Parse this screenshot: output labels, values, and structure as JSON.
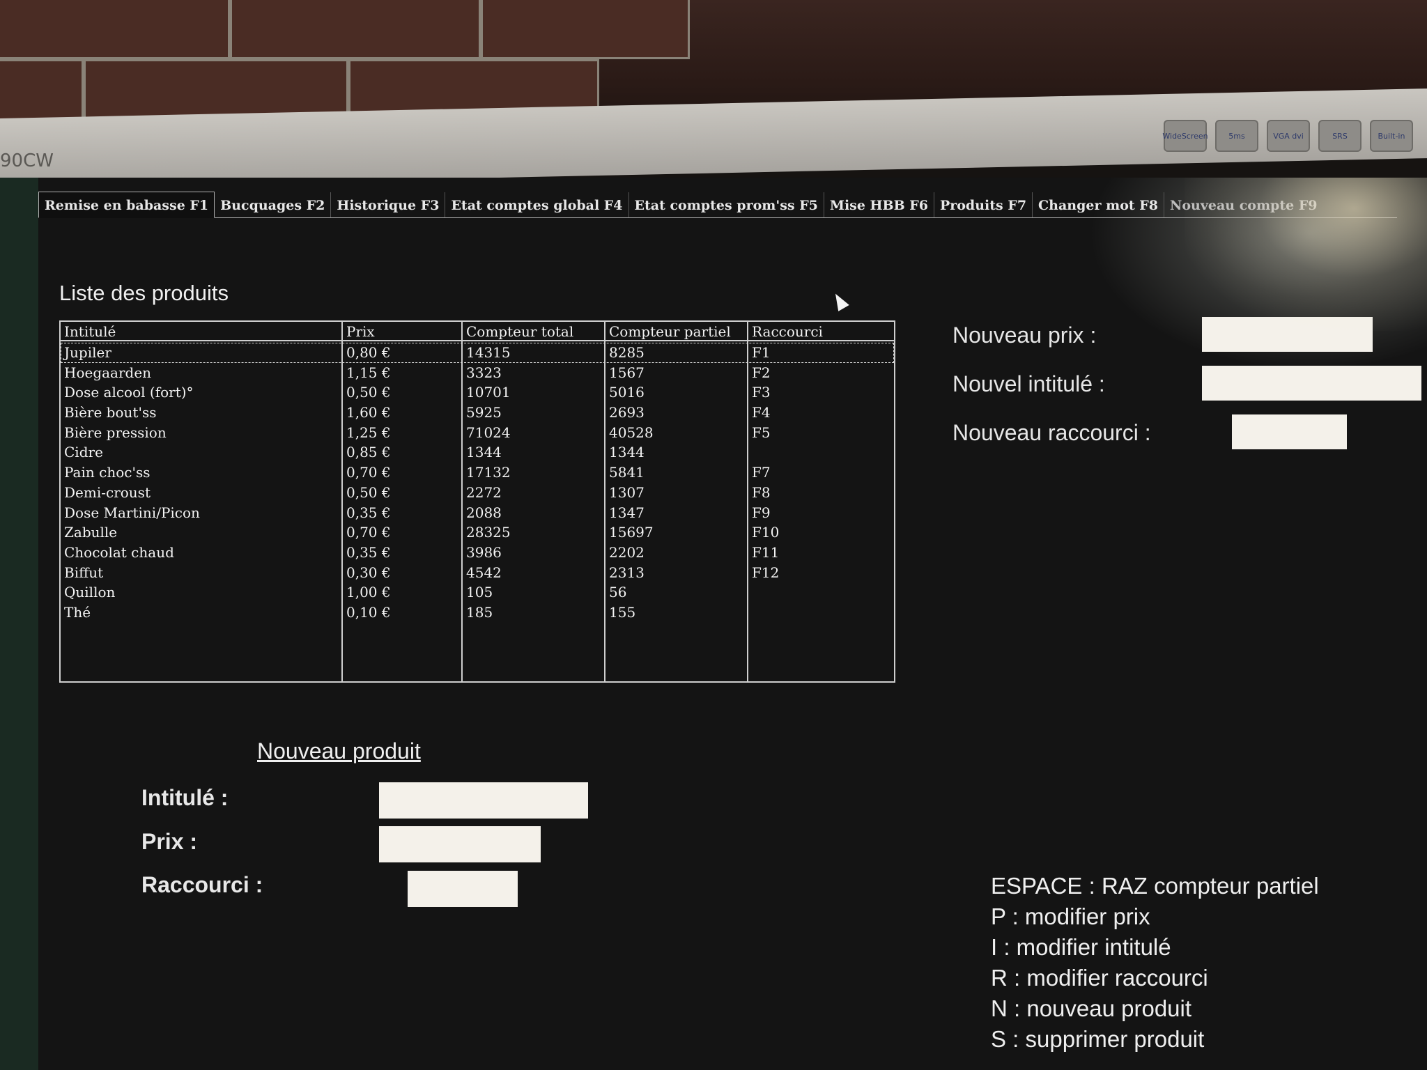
{
  "bezel": {
    "model": "90CW",
    "badges": [
      "WideScreen",
      "5ms",
      "VGA dvi",
      "SRS",
      "Built-in"
    ]
  },
  "tabs": [
    {
      "label": "Remise en babasse F1",
      "active": true
    },
    {
      "label": "Bucquages F2",
      "active": false
    },
    {
      "label": "Historique F3",
      "active": false
    },
    {
      "label": "Etat comptes global F4",
      "active": false
    },
    {
      "label": "Etat comptes prom'ss F5",
      "active": false
    },
    {
      "label": "Mise HBB F6",
      "active": false
    },
    {
      "label": "Produits F7",
      "active": false
    },
    {
      "label": "Changer mot F8",
      "active": false
    },
    {
      "label": "Nouveau compte F9",
      "active": false
    }
  ],
  "products": {
    "title": "Liste des produits",
    "columns": [
      "Intitulé",
      "Prix",
      "Compteur total",
      "Compteur partiel",
      "Raccourci"
    ],
    "rows": [
      [
        "Jupiler",
        "0,80 €",
        "14315",
        "8285",
        "F1"
      ],
      [
        "Hoegaarden",
        "1,15 €",
        "3323",
        "1567",
        "F2"
      ],
      [
        "Dose alcool (fort)°",
        "0,50 €",
        "10701",
        "5016",
        "F3"
      ],
      [
        "Bière bout'ss",
        "1,60 €",
        "5925",
        "2693",
        "F4"
      ],
      [
        "Bière pression",
        "1,25 €",
        "71024",
        "40528",
        "F5"
      ],
      [
        "Cidre",
        "0,85 €",
        "1344",
        "1344",
        ""
      ],
      [
        "Pain choc'ss",
        "0,70 €",
        "17132",
        "5841",
        "F7"
      ],
      [
        "Demi-croust",
        "0,50 €",
        "2272",
        "1307",
        "F8"
      ],
      [
        "Dose Martini/Picon",
        "0,35 €",
        "2088",
        "1347",
        "F9"
      ],
      [
        "Zabulle",
        "0,70 €",
        "28325",
        "15697",
        "F10"
      ],
      [
        "Chocolat chaud",
        "0,35 €",
        "3986",
        "2202",
        "F11"
      ],
      [
        "Biffut",
        "0,30 €",
        "4542",
        "2313",
        "F12"
      ],
      [
        "Quillon",
        "1,00 €",
        "105",
        "56",
        ""
      ],
      [
        "Thé",
        "0,10 €",
        "185",
        "155",
        ""
      ]
    ]
  },
  "edit": {
    "new_price_label": "Nouveau prix :",
    "new_title_label": "Nouvel intitulé :",
    "new_shortcut_label": "Nouveau raccourci :",
    "new_price_value": "",
    "new_title_value": "",
    "new_shortcut_value": ""
  },
  "new_product": {
    "title": "Nouveau produit",
    "title_label": "Intitulé :",
    "price_label": "Prix :",
    "shortcut_label": "Raccourci :",
    "title_value": "",
    "price_value": "",
    "shortcut_value": ""
  },
  "shortcuts": [
    "ESPACE : RAZ compteur partiel",
    "P : modifier prix",
    "I : modifier intitulé",
    "R : modifier raccourci",
    "N : nouveau produit",
    "S : supprimer produit"
  ]
}
